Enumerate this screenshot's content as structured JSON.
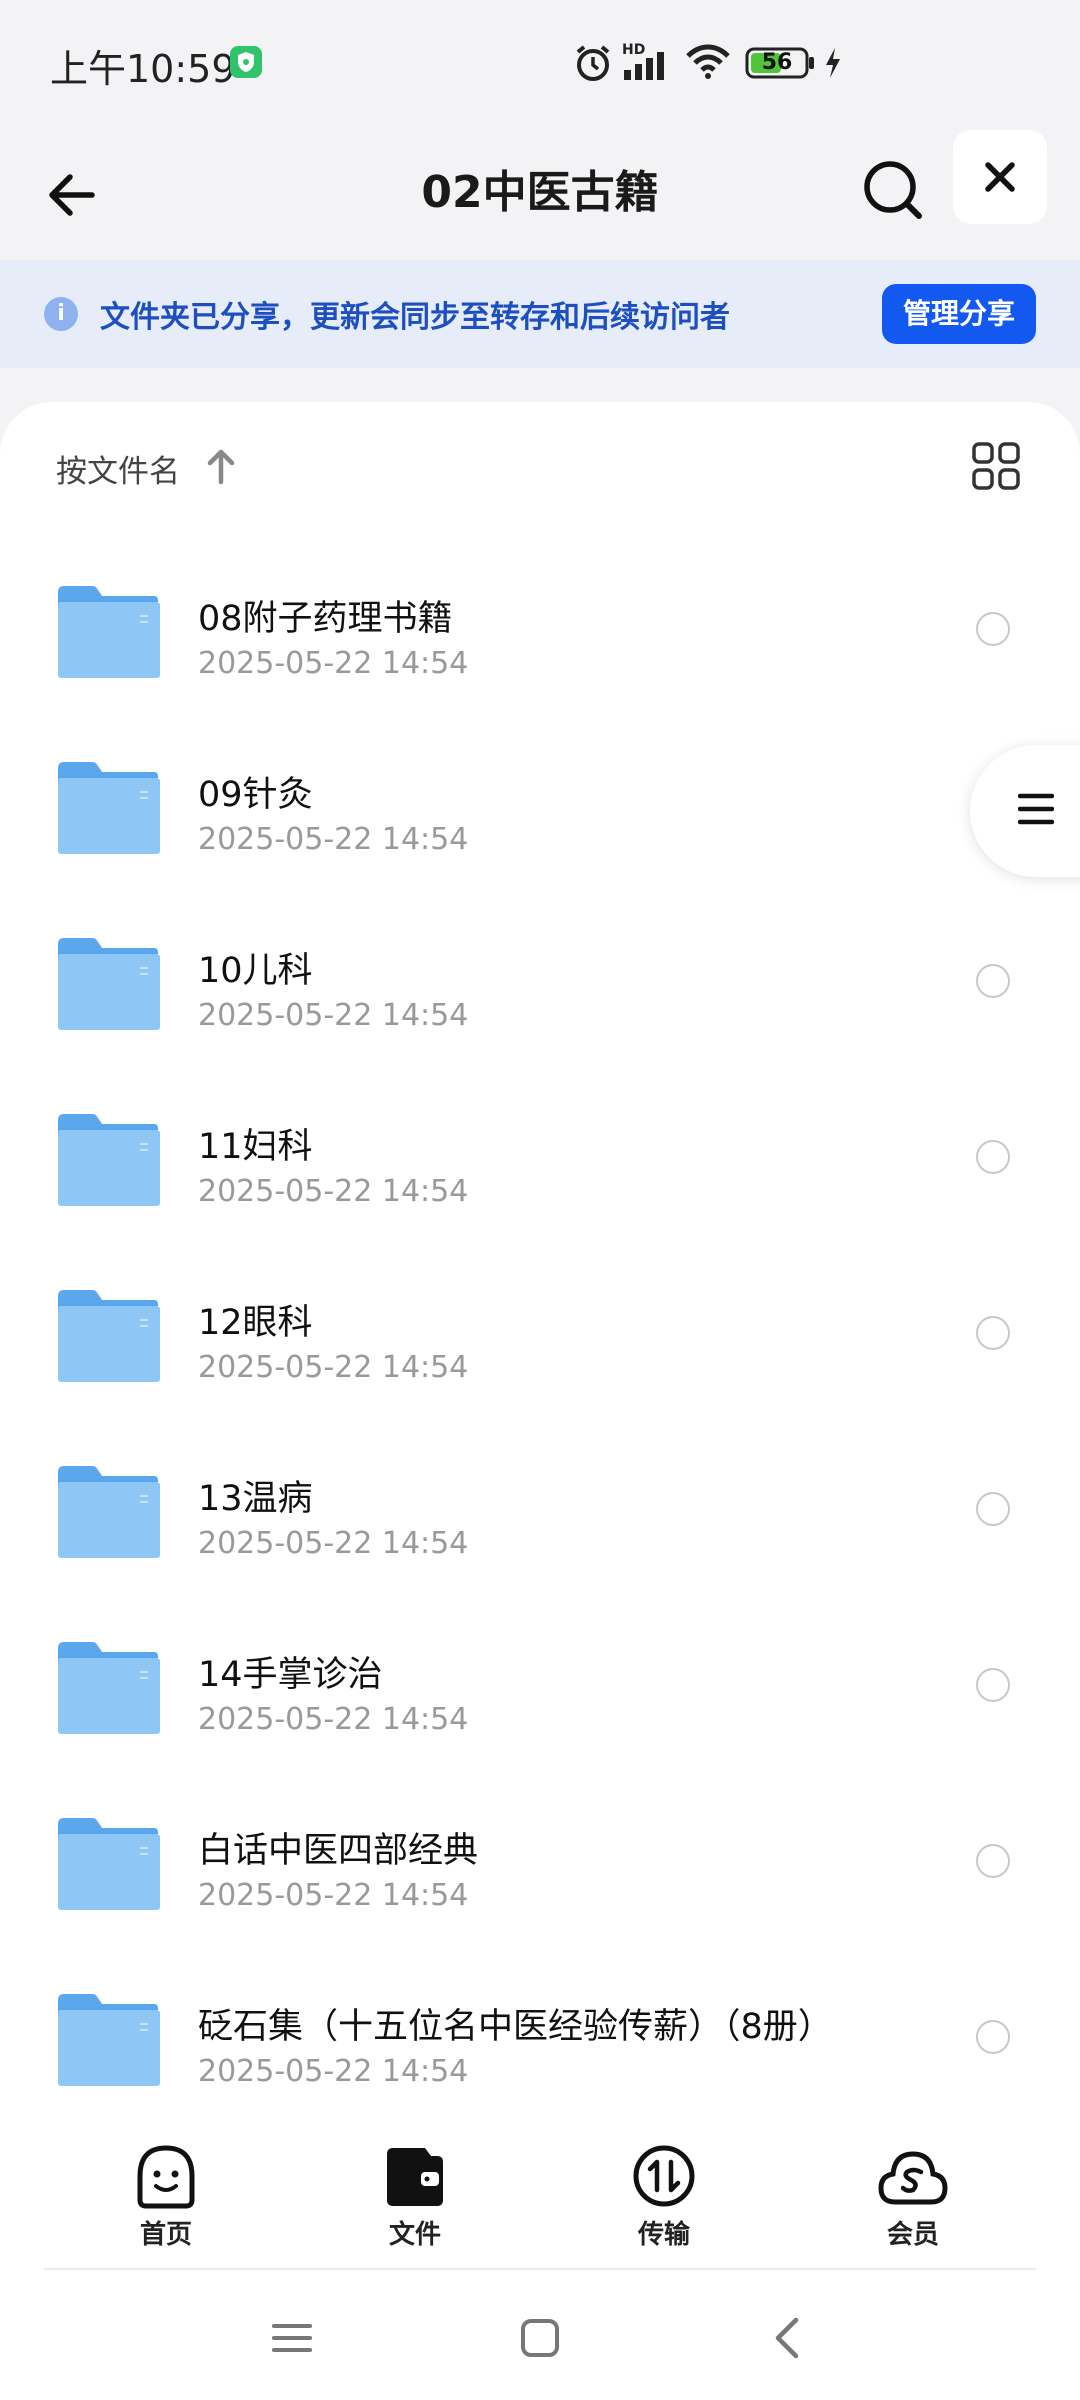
{
  "status_bar": {
    "time": "上午10:59",
    "battery": "56",
    "network_badge": "HD"
  },
  "header": {
    "title": "02中医古籍",
    "back_icon": "arrow-left-icon",
    "search_icon": "search-icon",
    "close_icon": "close-icon"
  },
  "share_banner": {
    "text": "文件夹已分享，更新会同步至转存和后续访问者",
    "button": "管理分享",
    "accent": "#1359f0"
  },
  "sort": {
    "label": "按文件名"
  },
  "files": [
    {
      "name": "08附子药理书籍",
      "date": "2025-05-22 14:54"
    },
    {
      "name": "09针灸",
      "date": "2025-05-22 14:54"
    },
    {
      "name": "10儿科",
      "date": "2025-05-22 14:54"
    },
    {
      "name": "11妇科",
      "date": "2025-05-22 14:54"
    },
    {
      "name": "12眼科",
      "date": "2025-05-22 14:54"
    },
    {
      "name": "13温病",
      "date": "2025-05-22 14:54"
    },
    {
      "name": "14手掌诊治",
      "date": "2025-05-22 14:54"
    },
    {
      "name": "白话中医四部经典",
      "date": "2025-05-22 14:54"
    },
    {
      "name": "砭石集（十五位名中医经验传薪）（8册）",
      "date": "2025-05-22 14:54"
    }
  ],
  "tabs": [
    {
      "label": "首页",
      "icon": "home-smile-icon"
    },
    {
      "label": "文件",
      "icon": "wallet-files-icon"
    },
    {
      "label": "传输",
      "icon": "transfer-icon"
    },
    {
      "label": "会员",
      "icon": "cloud-vip-icon"
    }
  ]
}
